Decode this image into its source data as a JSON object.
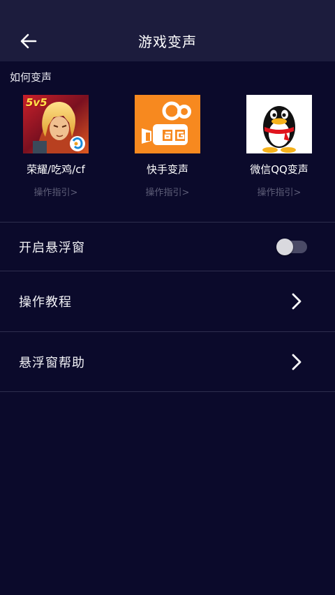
{
  "header": {
    "title": "游戏变声",
    "back_icon": "arrow-left-icon"
  },
  "section": {
    "title": "如何变声"
  },
  "games": [
    {
      "name": "荣耀/吃鸡/cf",
      "guide": "操作指引>",
      "icon": "honor-of-kings-icon",
      "badge_text": "5v5"
    },
    {
      "name": "快手变声",
      "guide": "操作指引>",
      "icon": "kuaishou-icon"
    },
    {
      "name": "微信QQ变声",
      "guide": "操作指引>",
      "icon": "qq-penguin-icon"
    }
  ],
  "settings": {
    "floating_window": {
      "label": "开启悬浮窗",
      "enabled": false
    },
    "tutorial": {
      "label": "操作教程"
    },
    "floating_help": {
      "label": "悬浮窗帮助"
    }
  },
  "colors": {
    "background": "#0b0a2b",
    "header": "#1c1c3d",
    "divider": "#2e2e4e",
    "muted_text": "#5e5e78",
    "kuaishou_orange": "#f7891f"
  }
}
